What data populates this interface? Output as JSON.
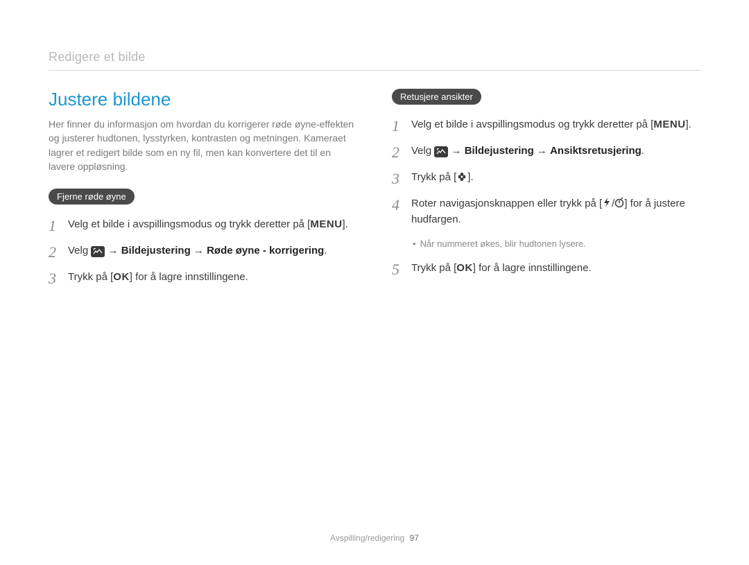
{
  "header": "Redigere et bilde",
  "section_title": "Justere bildene",
  "intro": "Her finner du informasjon om hvordan du korrigerer røde øyne-effekten og justerer hudtonen, lysstyrken, kontrasten og metningen. Kameraet lagrer et redigert bilde som en ny fil, men kan konvertere det til en lavere oppløsning.",
  "left": {
    "pill": "Fjerne røde øyne",
    "steps": {
      "s1a": "Velg et bilde i avspillingsmodus og trykk deretter på [",
      "s1_menu": "MENU",
      "s1b": "].",
      "s2a": "Velg ",
      "s2_arrow1": " → ",
      "s2_b1": "Bildejustering",
      "s2_arrow2": " → ",
      "s2_b2": "Røde øyne - korrigering",
      "s2_end": ".",
      "s3a": "Trykk på [",
      "s3_ok": "OK",
      "s3b": "] for å lagre innstillingene."
    }
  },
  "right": {
    "pill": "Retusjere ansikter",
    "steps": {
      "s1a": "Velg et bilde i avspillingsmodus og trykk deretter på [",
      "s1_menu": "MENU",
      "s1b": "].",
      "s2a": "Velg ",
      "s2_arrow1": " → ",
      "s2_b1": "Bildejustering",
      "s2_arrow2": " → ",
      "s2_b2": "Ansiktsretusjering",
      "s2_end": ".",
      "s3a": "Trykk på [",
      "s3b": "].",
      "s4a": "Roter navigasjonsknappen eller trykk på [",
      "s4_sep": "/",
      "s4b": "] for å justere hudfargen.",
      "s4_note": "Når nummeret økes, blir hudtonen lysere.",
      "s5a": "Trykk på [",
      "s5_ok": "OK",
      "s5b": "] for å lagre innstillingene."
    }
  },
  "step_numbers": {
    "n1": "1",
    "n2": "2",
    "n3": "3",
    "n4": "4",
    "n5": "5"
  },
  "footer": {
    "section": "Avspilling/redigering",
    "page": "97"
  }
}
